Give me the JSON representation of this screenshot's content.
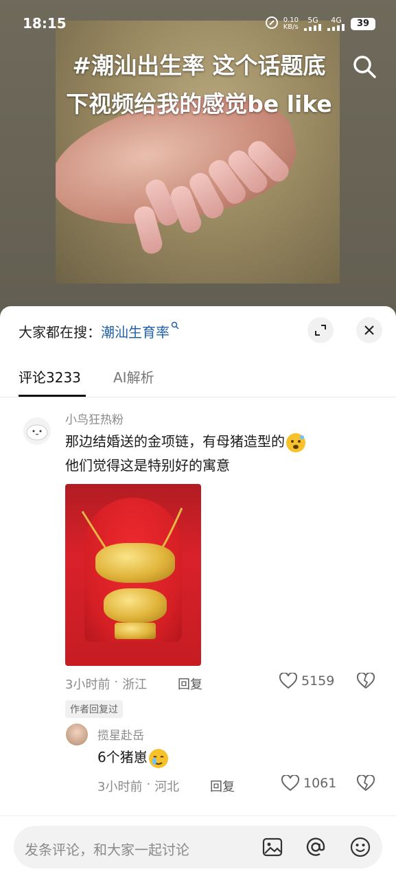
{
  "status_bar": {
    "time": "18:15",
    "net_speed_top": "0.10",
    "net_speed_unit": "KB/s",
    "signal1": "5G",
    "signal2": "4G",
    "battery": "39"
  },
  "video": {
    "caption": "#潮汕出生率 这个话题底下视频给我的感觉be like"
  },
  "sheet": {
    "hot_search_prefix": "大家都在搜：",
    "hot_search_keyword": "潮汕生育率",
    "tabs": [
      {
        "label": "评论3233",
        "active": true
      },
      {
        "label": "AI解析",
        "active": false
      }
    ]
  },
  "comments": [
    {
      "username": "小鸟狂热粉",
      "line1": "那边结婚送的金项链，有母猪造型的",
      "line2": "他们觉得这是特别好的寓意",
      "time": "3小时前",
      "location": "浙江",
      "reply_label": "回复",
      "likes": "5159",
      "author_badge": "作者回复过"
    },
    {
      "username": "揽星赴岳",
      "text": "6个猪崽",
      "time": "3小时前",
      "location": "河北",
      "reply_label": "回复",
      "likes": "1061"
    }
  ],
  "composer": {
    "placeholder": "发条评论，和大家一起讨论"
  },
  "colors": {
    "keyword": "#1f5fa8",
    "muted": "#8a8a8a"
  }
}
